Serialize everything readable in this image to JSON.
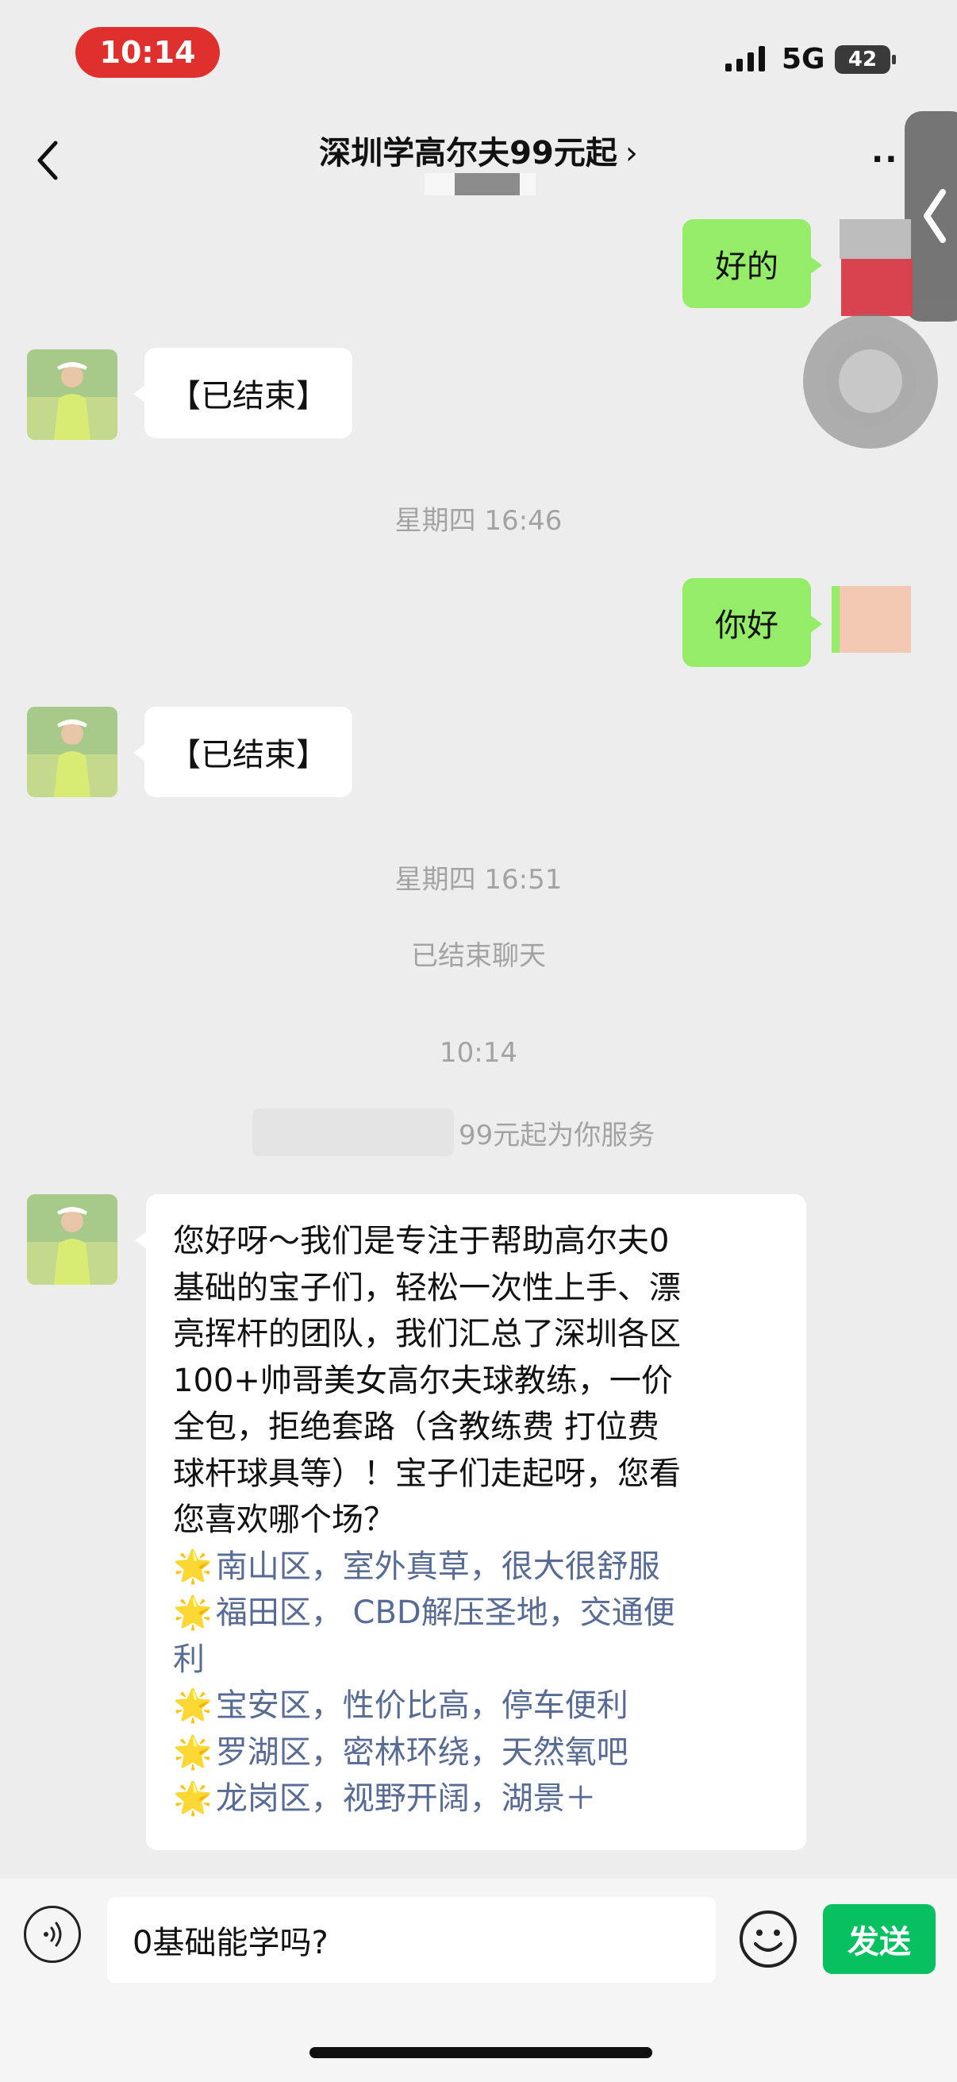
{
  "status_bar": {
    "time": "10:14",
    "network": "5G",
    "battery": "42"
  },
  "header": {
    "title": "深圳学高尔夫99元起",
    "chevron": "›",
    "more": "··"
  },
  "messages": {
    "m1": "好的",
    "m2": "【已结束】",
    "ts1": "星期四 16:46",
    "m3": "你好",
    "m4": "【已结束】",
    "ts2": "星期四 16:51",
    "sys1": "已结束聊天",
    "ts3": "10:14",
    "sys2": "99元起为你服务",
    "long_lines": [
      "您好呀～我们是专注于帮助高尔夫0",
      "基础的宝子们，轻松一次性上手、漂",
      "亮挥杆的团队，我们汇总了深圳各区",
      "100+帅哥美女高尔夫球教练，一价",
      "全包，拒绝套路（含教练费 打位费",
      "球杆球具等）！宝子们走起呀，您看",
      "您喜欢哪个场？"
    ],
    "options": [
      "南山区，室外真草，很大很舒服",
      "福田区， CBD解压圣地，交通便",
      "利",
      "宝安区，性价比高，停车便利",
      "罗湖区，密林环绕，天然氧吧",
      "龙岗区，视野开阔，湖景＋"
    ],
    "star": "🌟"
  },
  "input_bar": {
    "input_value": "0基础能学吗?",
    "send_label": "发送"
  },
  "icons": {
    "back": "chevron-left-icon",
    "voice": "voice-icon",
    "emoji": "emoji-icon",
    "side_tab": "chevron-left-icon"
  },
  "colors": {
    "my_bubble": "#95ec69",
    "send_button": "#07c160",
    "time_pill": "#e0302d",
    "option_text": "#576b95"
  }
}
